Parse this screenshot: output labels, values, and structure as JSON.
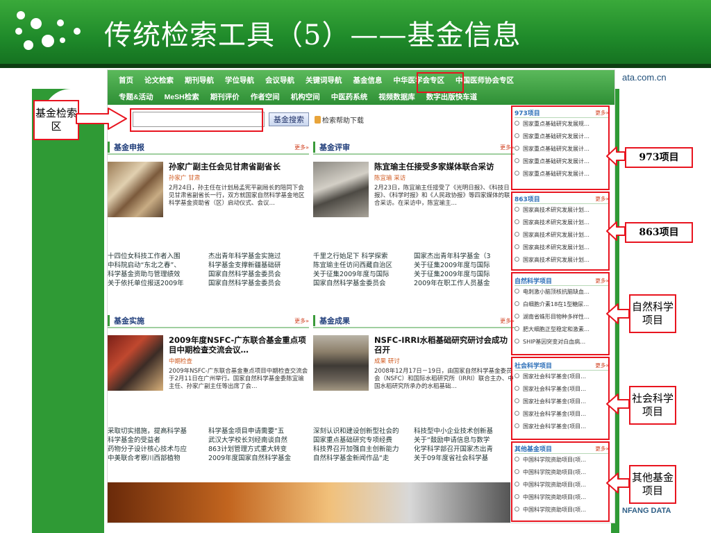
{
  "slide": {
    "title": "传统检索工具（5）——基金信息",
    "url_fragment": "ata.com.cn",
    "brand_fragment": "NFANG DATA"
  },
  "nav": {
    "row1": [
      "首页",
      "论文检索",
      "期刊导航",
      "学位导航",
      "会议导航",
      "关键词导航",
      "基金信息",
      "中华医学会专区",
      "中国医师协会专区"
    ],
    "row2": [
      "专题&活动",
      "MeSH检索",
      "期刊评价",
      "作者空间",
      "机构空间",
      "中医药系统",
      "视频数据库",
      "数字出版快车道"
    ]
  },
  "search": {
    "input_value": "",
    "button_label": "基金搜索",
    "help_link": "检索帮助下载"
  },
  "sections": {
    "apply": {
      "title": "基金申报",
      "more": "更多»",
      "headline": "孙家广副主任会见甘肃省副省长",
      "sub": "孙家广 甘肃",
      "text": "2月24日，孙主任在计划局孟宪平副局长的陪同下会见甘肃省副省长一行，双方就国家自然科学基金地区科学基金资助省（区）启动仪式、会议…",
      "links": [
        [
          "十四位女科技工作者入围",
          "杰出青年科学基金实施过"
        ],
        [
          "中科院启动“东北之春”、",
          "科学基金支撑新疆基础研"
        ],
        [
          "科学基金资助与管理绩效",
          "国家自然科学基金委员会"
        ],
        [
          "关于依托单位报送2009年",
          "国家自然科学基金委员会"
        ]
      ]
    },
    "review": {
      "title": "基金评审",
      "more": "更多»",
      "headline": "陈宜瑜主任接受多家媒体联合采访",
      "sub": "陈宜瑜 采访",
      "text": "2月23日，陈宜瑜主任接受了《光明日报》、《科技日报》、《科学时报》和《人民政协报》等四家媒体的联合采访。在采访中，陈宜瑜主…",
      "links": [
        [
          "千里之行始足下 科学探索",
          "国家杰出青年科学基金（3"
        ],
        [
          "陈宜瑜主任访问西藏自治区",
          "关于征集2009年度与国际"
        ],
        [
          "关于征集2009年度与国际",
          "关于征集2009年度与国际"
        ],
        [
          "国家自然科学基金委员会",
          "2009年在职工作人员基金"
        ]
      ]
    },
    "implement": {
      "title": "基金实施",
      "more": "更多»",
      "headline": "2009年度NSFC-广东联合基金重点项目中期检查交流会议…",
      "sub": "中期检查",
      "text": "2009年NSFC-广东联合基金重点项目中期检查交流会于2月11日在广州举行。国家自然科学基金委陈宜瑜主任、孙家广副主任等出席了会…",
      "links": [
        [
          "采取切实措施，提高科学基",
          "科学基金项目申请需要“五"
        ],
        [
          "科学基金的受益者",
          "武汉大学校长刘经南谈自然"
        ],
        [
          "药物分子设计核心技术与应",
          "863计划管理方式重大转变"
        ],
        [
          "中美联合考察川西部植物",
          "2009年度国家自然科学基金"
        ]
      ]
    },
    "result": {
      "title": "基金成果",
      "more": "更多»",
      "headline": "NSFC-IRRI水稻基础研究研讨会成功召开",
      "sub": "成果 研讨",
      "text": "2008年12月17日－19日，由国家自然科学基金委员会（NSFC）和国际水稻研究所（IRRI）联合主办、中国水稻研究所承办的水稻基础…",
      "links": [
        [
          "深刻认识和建设创新型社会的",
          "科技型中小企业技术创新基"
        ],
        [
          "国家重点基础研究专项经费",
          "关于“鼓励申请信息与数学"
        ],
        [
          "科技界召开加强自主创新能力",
          "化学科学部召开国家杰出青"
        ],
        [
          "自然科学基金新闻作品“走",
          "关于09年度省社会科学基"
        ]
      ]
    }
  },
  "sidebar": [
    {
      "title": "973项目",
      "more": "更多»",
      "items": [
        "国家重点基础研究发展规…",
        "国家重点基础研究发展计…",
        "国家重点基础研究发展计…",
        "国家重点基础研究发展计…",
        "国家重点基础研究发展计…"
      ]
    },
    {
      "title": "863项目",
      "more": "更多»",
      "items": [
        "国家高技术研究发展计划…",
        "国家高技术研究发展计划…",
        "国家高技术研究发展计划…",
        "国家高技术研究发展计划…",
        "国家高技术研究发展计划…"
      ]
    },
    {
      "title": "自然科学项目",
      "more": "更多»",
      "items": [
        "电刺激小脑顶核抗脑缺血…",
        "白细胞介素18在1型糖尿…",
        "湖南省蛛形目物种多样性…",
        "肥大细胞正型稳定和激素…",
        "SHIP基因突变对白血病…"
      ]
    },
    {
      "title": "社会科学项目",
      "more": "更多»",
      "items": [
        "国家社会科学基金(项目…",
        "国家社会科学基金(项目…",
        "国家社会科学基金(项目…",
        "国家社会科学基金(项目…",
        "国家社会科学基金(项目…"
      ]
    },
    {
      "title": "其他基金项目",
      "more": "更多»",
      "items": [
        "中国科学院资助项目(项…",
        "中国科学院资助项目(项…",
        "中国科学院资助项目(项…",
        "中国科学院资助项目(项…",
        "中国科学院资助项目(项…"
      ]
    }
  ],
  "callouts": {
    "search_zone": "基金检索区",
    "p973": "973项目",
    "p863": "863项目",
    "natural": "自然科学项目",
    "social": "社会科学项目",
    "other": "其他基金项目"
  },
  "colors": {
    "header_green": "#2a9632",
    "highlight_red": "#e8141f",
    "nav_green": "#3aa040"
  }
}
